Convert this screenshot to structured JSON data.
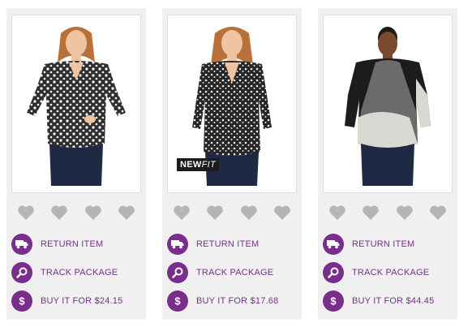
{
  "products": [
    {
      "badge": null,
      "actions": {
        "return": "RETURN ITEM",
        "track": "TRACK PACKAGE",
        "buy": "BUY IT FOR $24.15"
      },
      "colors": {
        "top_bg": "#333333",
        "print": "#ffffff",
        "pants": "#1e2a44"
      }
    },
    {
      "badge": {
        "new": "NEW",
        "fit": "FIT"
      },
      "actions": {
        "return": "RETURN ITEM",
        "track": "TRACK PACKAGE",
        "buy": "BUY IT FOR $17.68"
      },
      "colors": {
        "top_bg": "#2a2a2a",
        "print": "#e8e8e8",
        "pants": "#1e2a44"
      }
    },
    {
      "badge": null,
      "actions": {
        "return": "RETURN ITEM",
        "track": "TRACK PACKAGE",
        "buy": "BUY IT FOR $44.45"
      },
      "colors": {
        "top_bg": "#1c1c1c",
        "print": "#d9d9d4",
        "pants": "#1e2a44"
      }
    }
  ],
  "heart_count": 4,
  "icons": {
    "return": "delivery-truck-icon",
    "track": "magnifier-icon",
    "buy": "dollar-icon",
    "rating": "heart-icon"
  },
  "colors": {
    "accent": "#7b2d8e",
    "card_bg": "#f0f0f0",
    "heart": "#b5b5b5"
  }
}
